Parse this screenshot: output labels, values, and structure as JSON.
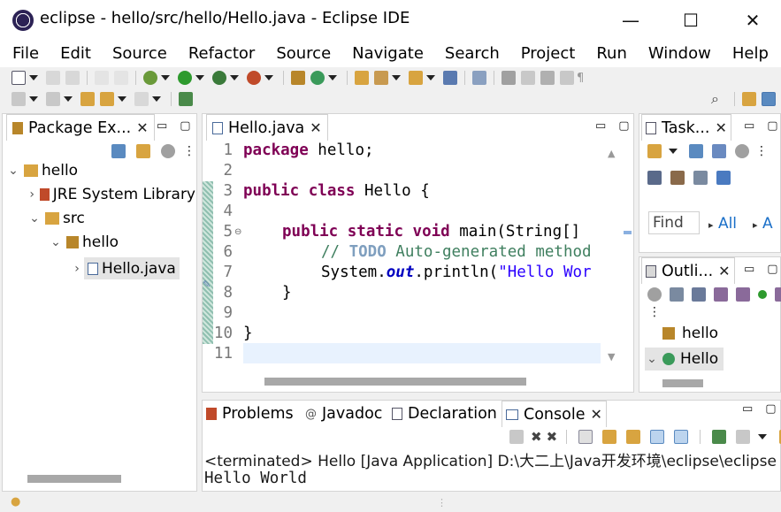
{
  "window": {
    "title": "eclipse - hello/src/hello/Hello.java - Eclipse IDE",
    "minimize": "—",
    "maximize": "☐",
    "close": "✕"
  },
  "menu": [
    "File",
    "Edit",
    "Source",
    "Refactor",
    "Source",
    "Navigate",
    "Search",
    "Project",
    "Run",
    "Window",
    "Help"
  ],
  "package_explorer": {
    "tab": "Package Ex...",
    "tree": {
      "project": "hello",
      "jre": "JRE System Library",
      "src": "src",
      "package": "hello",
      "file": "Hello.java"
    }
  },
  "editor": {
    "tab": "Hello.java",
    "line_numbers": [
      "1",
      "2",
      "3",
      "4",
      "5",
      "6",
      "7",
      "8",
      "9",
      "10",
      "11"
    ],
    "code": {
      "l1_kw": "package",
      "l1_rest": " hello;",
      "l3_kw1": "public",
      "l3_kw2": "class",
      "l3_rest": " Hello {",
      "l5_kw1": "public",
      "l5_kw2": "static",
      "l5_kw3": "void",
      "l5_rest": " main(String[]",
      "l6_cm1": "// ",
      "l6_todo": "TODO",
      "l6_cm2": " Auto-generated method",
      "l7_a": "System.",
      "l7_field": "out",
      "l7_b": ".println(",
      "l7_str": "\"Hello Wor",
      "l8": "}",
      "l10": "}"
    }
  },
  "task_list": {
    "tab": "Task...",
    "find_placeholder": "Find",
    "all_label": "All",
    "a_label": "A"
  },
  "outline": {
    "tab": "Outli...",
    "items": [
      "hello",
      "Hello"
    ]
  },
  "bottom_tabs": {
    "problems": "Problems",
    "javadoc": "Javadoc",
    "declaration": "Declaration",
    "console": "Console"
  },
  "console": {
    "header": "<terminated> Hello [Java Application] D:\\大二上\\Java开发环境\\eclipse\\eclipse",
    "output": "Hello World"
  },
  "colors": {
    "keyword": "#7f0055",
    "comment": "#3f7f5f",
    "string": "#2a00ff",
    "current_line": "#e8f2fe",
    "selection": "#e4e4e4"
  }
}
